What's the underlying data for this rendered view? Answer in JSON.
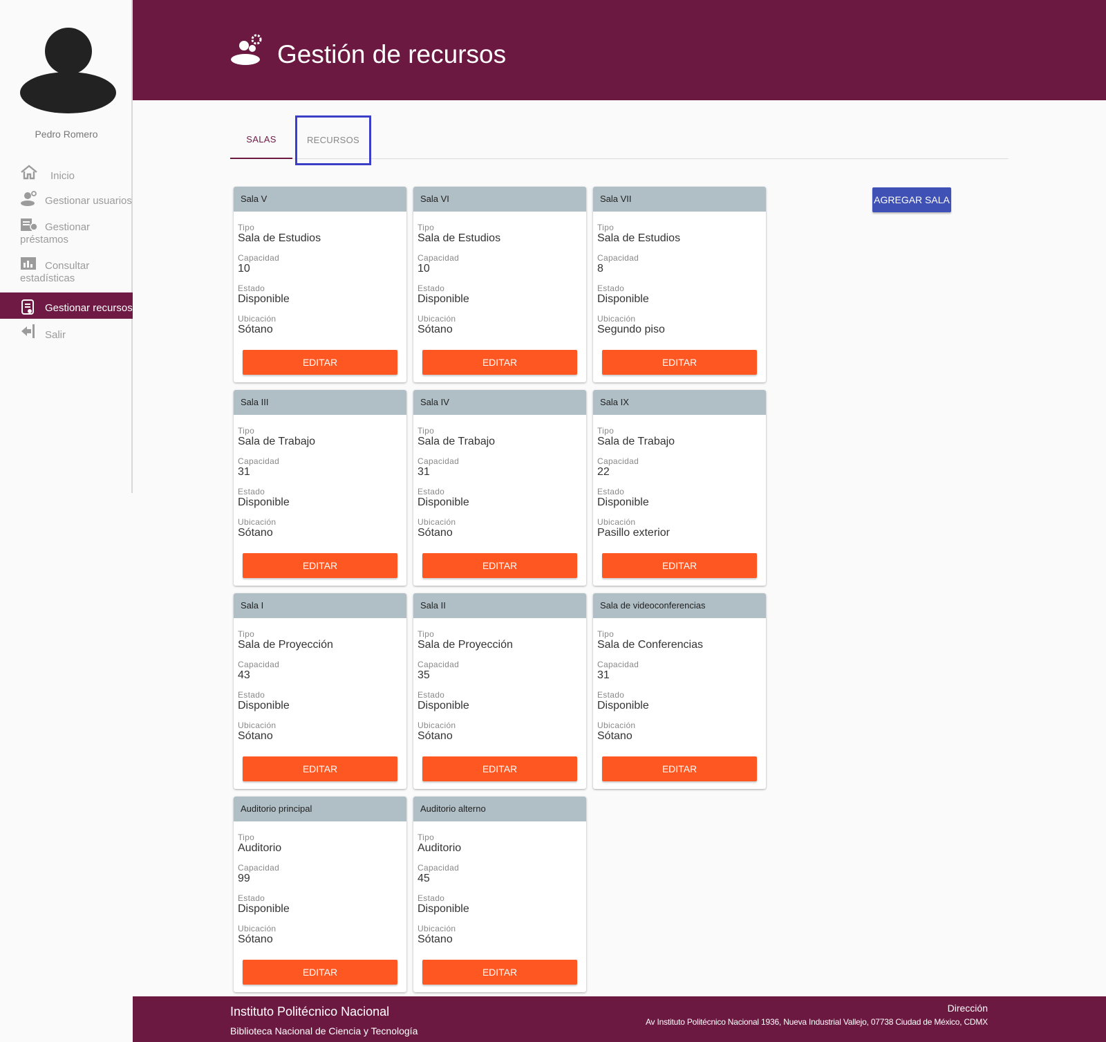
{
  "user": {
    "name": "Pedro Romero"
  },
  "sidebar": {
    "items": [
      {
        "label": "Inicio",
        "icon": "home-icon"
      },
      {
        "label": "Gestionar usuarios",
        "icon": "users-gear-icon"
      },
      {
        "label": "Gestionar préstamos",
        "icon": "loans-icon"
      },
      {
        "label": "Consultar estadísticas",
        "icon": "stats-icon"
      },
      {
        "label": "Gestionar recursos",
        "icon": "resources-icon",
        "active": true
      },
      {
        "label": "Salir",
        "icon": "logout-icon"
      }
    ]
  },
  "header": {
    "title": "Gestión de recursos",
    "icon": "resources-people-gear-icon"
  },
  "tabs": {
    "salas": "SALAS",
    "recursos": "RECURSOS"
  },
  "actions": {
    "add_label": "AGREGAR SALA"
  },
  "fields": {
    "tipo": "Tipo",
    "capacidad": "Capacidad",
    "estado": "Estado",
    "ubicacion": "Ubicación",
    "edit": "EDITAR"
  },
  "rooms": [
    {
      "name": "Sala V",
      "tipo": "Sala de Estudios",
      "capacidad": "10",
      "estado": "Disponible",
      "ubicacion": "Sótano"
    },
    {
      "name": "Sala VI",
      "tipo": "Sala de Estudios",
      "capacidad": "10",
      "estado": "Disponible",
      "ubicacion": "Sótano"
    },
    {
      "name": "Sala VII",
      "tipo": "Sala de Estudios",
      "capacidad": "8",
      "estado": "Disponible",
      "ubicacion": "Segundo piso"
    },
    {
      "name": "Sala III",
      "tipo": "Sala de Trabajo",
      "capacidad": "31",
      "estado": "Disponible",
      "ubicacion": "Sótano"
    },
    {
      "name": "Sala IV",
      "tipo": "Sala de Trabajo",
      "capacidad": "31",
      "estado": "Disponible",
      "ubicacion": "Sótano"
    },
    {
      "name": "Sala IX",
      "tipo": "Sala de Trabajo",
      "capacidad": "22",
      "estado": "Disponible",
      "ubicacion": "Pasillo exterior"
    },
    {
      "name": "Sala I",
      "tipo": "Sala de Proyección",
      "capacidad": "43",
      "estado": "Disponible",
      "ubicacion": "Sótano"
    },
    {
      "name": "Sala II",
      "tipo": "Sala de Proyección",
      "capacidad": "35",
      "estado": "Disponible",
      "ubicacion": "Sótano"
    },
    {
      "name": "Sala de videoconferencias",
      "tipo": "Sala de Conferencias",
      "capacidad": "31",
      "estado": "Disponible",
      "ubicacion": "Sótano"
    },
    {
      "name": "Auditorio principal",
      "tipo": "Auditorio",
      "capacidad": "99",
      "estado": "Disponible",
      "ubicacion": "Sótano"
    },
    {
      "name": "Auditorio alterno",
      "tipo": "Auditorio",
      "capacidad": "45",
      "estado": "Disponible",
      "ubicacion": "Sótano"
    }
  ],
  "footer": {
    "institution": "Instituto Politécnico Nacional",
    "library": "Biblioteca Nacional de Ciencia y Tecnología",
    "address_label": "Dirección",
    "address": "Av Instituto Politécnico Nacional 1936, Nueva Industrial Vallejo, 07738 Ciudad de México, CDMX"
  },
  "colors": {
    "brand": "#6c1942",
    "edit": "#ff5722",
    "add": "#3f51b5",
    "card_header": "#b0bec5"
  }
}
